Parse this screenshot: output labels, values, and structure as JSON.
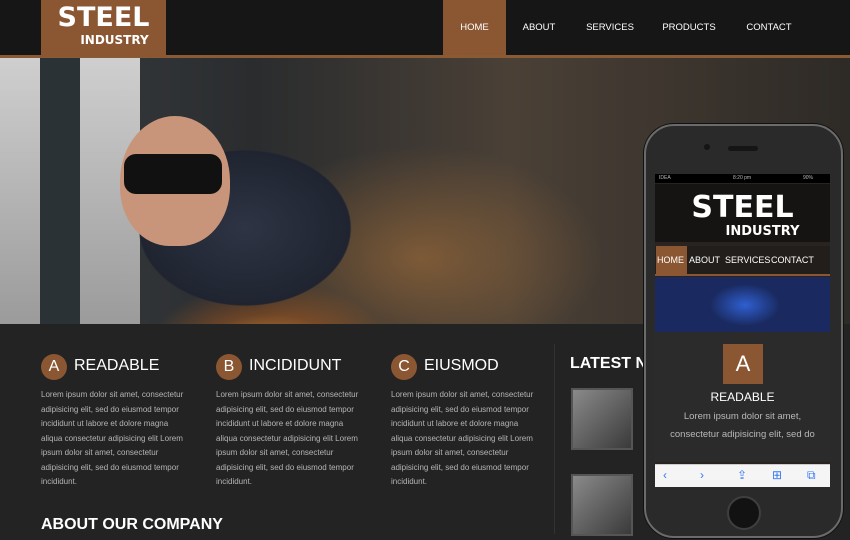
{
  "brand": {
    "line1": "STEEL",
    "line2": "INDUSTRY"
  },
  "nav": [
    {
      "label": "HOME",
      "active": true
    },
    {
      "label": "ABOUT"
    },
    {
      "label": "SERVICES"
    },
    {
      "label": "PRODUCTS"
    },
    {
      "label": "CONTACT"
    }
  ],
  "features": [
    {
      "badge": "A",
      "title": "READABLE",
      "text": "Lorem ipsum dolor sit amet, consectetur adipisicing elit, sed do eiusmod tempor incididunt ut labore et dolore magna aliqua consectetur adipisicing elit Lorem ipsum dolor sit amet, consectetur adipisicing elit, sed do eiusmod tempor incididunt."
    },
    {
      "badge": "B",
      "title": "INCIDIDUNT",
      "text": "Lorem ipsum dolor sit amet, consectetur adipisicing elit, sed do eiusmod tempor incididunt ut labore et dolore magna aliqua consectetur adipisicing elit Lorem ipsum dolor sit amet, consectetur adipisicing elit, sed do eiusmod tempor incididunt."
    },
    {
      "badge": "C",
      "title": "EIUSMOD",
      "text": "Lorem ipsum dolor sit amet, consectetur adipisicing elit, sed do eiusmod tempor incididunt ut labore et dolore magna aliqua consectetur adipisicing elit Lorem ipsum dolor sit amet, consectetur adipisicing elit, sed do eiusmod tempor incididunt."
    }
  ],
  "latest_news": {
    "title": "LATEST NI"
  },
  "about": {
    "title": "ABOUT OUR COMPANY"
  },
  "phone": {
    "status": {
      "carrier": "IDEA",
      "time": "8:20 pm",
      "battery": "90%"
    },
    "nav": [
      "HOME",
      "ABOUT",
      "SERVICES",
      "CONTACT"
    ],
    "feature": {
      "badge": "A",
      "title": "READABLE",
      "text": "Lorem ipsum dolor sit amet, consectetur adipisicing elit, sed do"
    },
    "toolbar_icons": [
      "back-icon",
      "forward-icon",
      "share-icon",
      "bookmarks-icon",
      "tabs-icon"
    ]
  },
  "colors": {
    "accent": "#8b5733",
    "background": "#232323",
    "topbar": "#161616"
  }
}
